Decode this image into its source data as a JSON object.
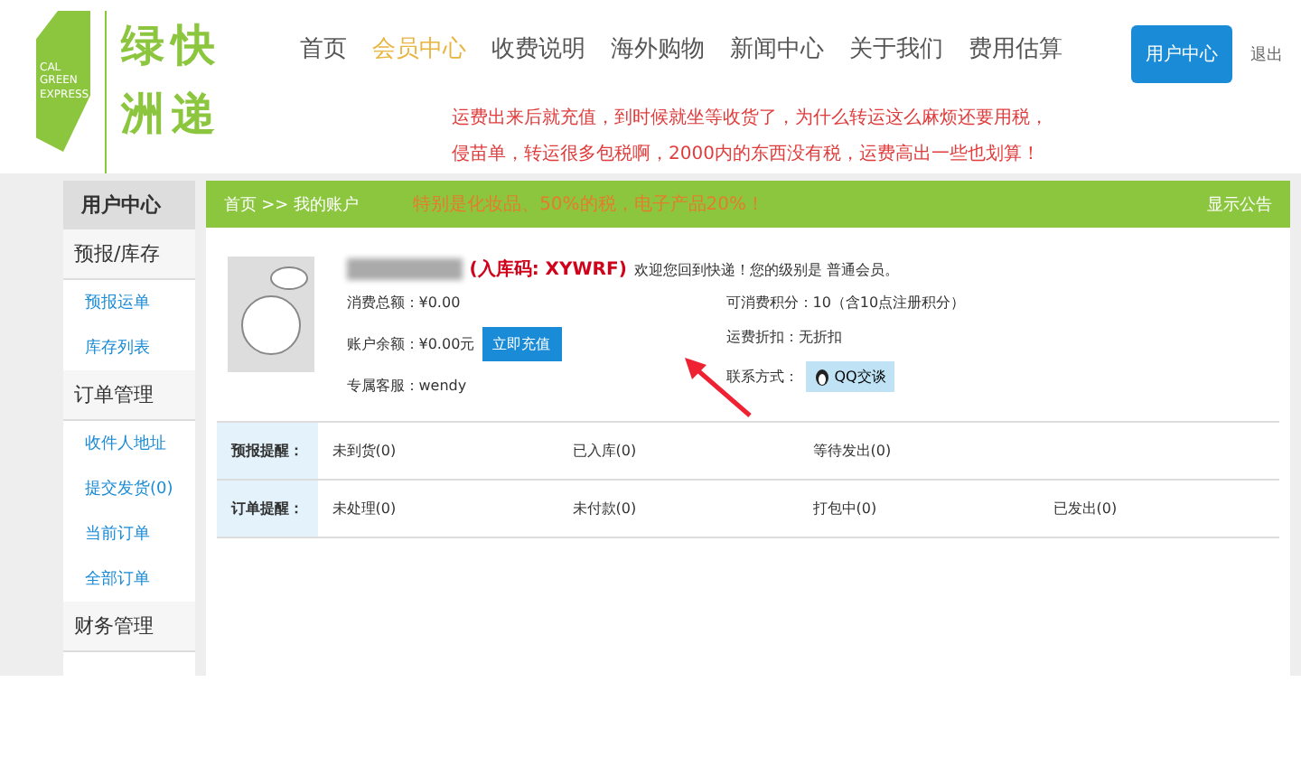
{
  "logo": {
    "badge": [
      "CAL",
      "GREEN",
      "EXPRESS"
    ],
    "name": [
      "绿快",
      "洲递"
    ]
  },
  "nav": [
    {
      "label": "首页",
      "selected": false
    },
    {
      "label": "会员中心",
      "selected": true
    },
    {
      "label": "收费说明",
      "selected": false
    },
    {
      "label": "海外购物",
      "selected": false
    },
    {
      "label": "新闻中心",
      "selected": false
    },
    {
      "label": "关于我们",
      "selected": false
    },
    {
      "label": "费用估算",
      "selected": false
    }
  ],
  "user_button": "用户中心",
  "logout": "退出",
  "notice": [
    "运费出来后就充值，到时候就坐等收货了，为什么转运这么麻烦还要用税，",
    "侵苗单，转运很多包税啊，2000内的东西没有税，运费高出一些也划算！",
    "特别是化妆品、50%的税，电子产品20%！"
  ],
  "sidebar": {
    "title": "用户中心",
    "sections": [
      {
        "title": "预报/库存",
        "items": [
          "预报运单",
          "库存列表"
        ]
      },
      {
        "title": "订单管理",
        "items": [
          "收件人地址",
          "提交发货(0)",
          "当前订单",
          "全部订单"
        ]
      },
      {
        "title": "财务管理"
      }
    ]
  },
  "breadcrumb": "首页 >> 我的账户",
  "announcement": "显示公告",
  "profile": {
    "code": "(入库码: XYWRF)",
    "welcome": "欢迎您回到快递！您的级别是 普通会员。",
    "left": [
      "消费总额：¥0.00",
      "账户余额：¥0.00元",
      "专属客服：wendy"
    ],
    "recharge": "立即充值",
    "right": [
      "可消费积分：10（含10点注册积分）",
      "运费折扣：无折扣",
      "联系方式："
    ],
    "qq": "QQ交谈"
  },
  "reminders": [
    {
      "label": "预报提醒：",
      "items": [
        "未到货(0)",
        "已入库(0)",
        "等待发出(0)"
      ]
    },
    {
      "label": "订单提醒：",
      "items": [
        "未处理(0)",
        "未付款(0)",
        "打包中(0)",
        "已发出(0)"
      ]
    }
  ]
}
